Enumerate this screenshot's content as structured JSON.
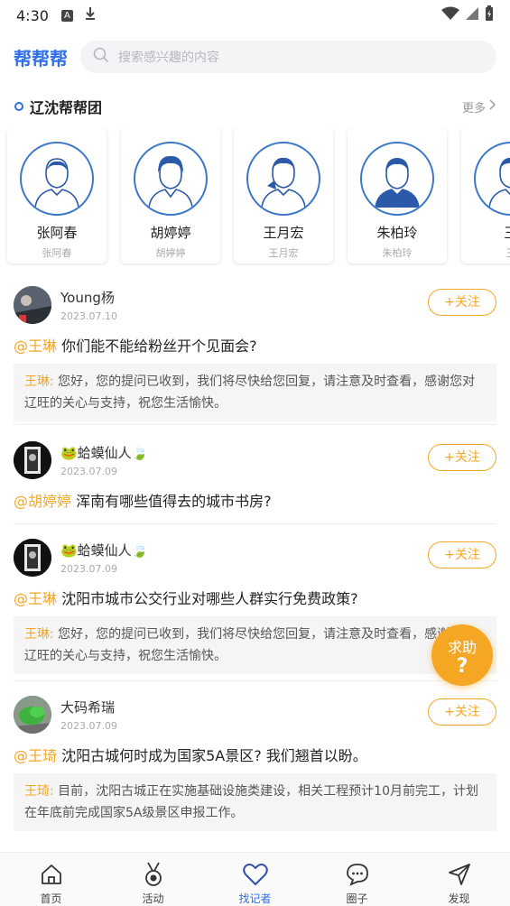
{
  "status_bar": {
    "time": "4:30",
    "icon_a": "A"
  },
  "header": {
    "logo": "帮帮帮",
    "search_placeholder": "搜索感兴趣的内容"
  },
  "section": {
    "title": "辽沈帮帮团",
    "more": "更多"
  },
  "experts": [
    {
      "name": "张阿春",
      "sub": "张阿春"
    },
    {
      "name": "胡婷婷",
      "sub": "胡婷婷"
    },
    {
      "name": "王月宏",
      "sub": "王月宏"
    },
    {
      "name": "朱柏玲",
      "sub": "朱柏玲"
    },
    {
      "name": "王",
      "sub": "王"
    }
  ],
  "follow_label": "+关注",
  "posts": [
    {
      "author": "Young杨",
      "date": "2023.07.10",
      "mention": "@王琳",
      "question": " 你们能不能给粉丝开个见面会?",
      "answer_who": "王琳:",
      "answer": " 您好，您的提问已收到，我们将尽快给您回复，请注意及时查看，感谢您对辽旺的关心与支持，祝您生活愉快。"
    },
    {
      "author": "🐸蛤蟆仙人🍃",
      "date": "2023.07.09",
      "mention": "@胡婷婷",
      "question": " 浑南有哪些值得去的城市书房?",
      "answer_who": "",
      "answer": ""
    },
    {
      "author": "🐸蛤蟆仙人🍃",
      "date": "2023.07.09",
      "mention": "@王琳",
      "question": " 沈阳市城市公交行业对哪些人群实行免费政策?",
      "answer_who": "王琳:",
      "answer": " 您好，您的提问已收到，我们将尽快给您回复，请注意及时查看，感谢您对辽旺的关心与支持，祝您生活愉快。"
    },
    {
      "author": "大码希瑞",
      "date": "2023.07.09",
      "mention": "@王琦",
      "question": " 沈阳古城何时成为国家5A景区? 我们翘首以盼。",
      "answer_who": "王琦:",
      "answer": " 目前，沈阳古城正在实施基础设施类建设，相关工程预计10月前完工，计划在年底前完成国家5A级景区申报工作。"
    }
  ],
  "help": {
    "label": "求助",
    "mark": "?"
  },
  "nav": [
    {
      "label": "首页",
      "icon": "home-icon"
    },
    {
      "label": "活动",
      "icon": "medal-icon"
    },
    {
      "label": "找记者",
      "icon": "heart-icon"
    },
    {
      "label": "圈子",
      "icon": "chat-icon"
    },
    {
      "label": "发现",
      "icon": "navigation-icon"
    }
  ],
  "colors": {
    "accent": "#f5a623",
    "brand": "#2f6ee8"
  }
}
